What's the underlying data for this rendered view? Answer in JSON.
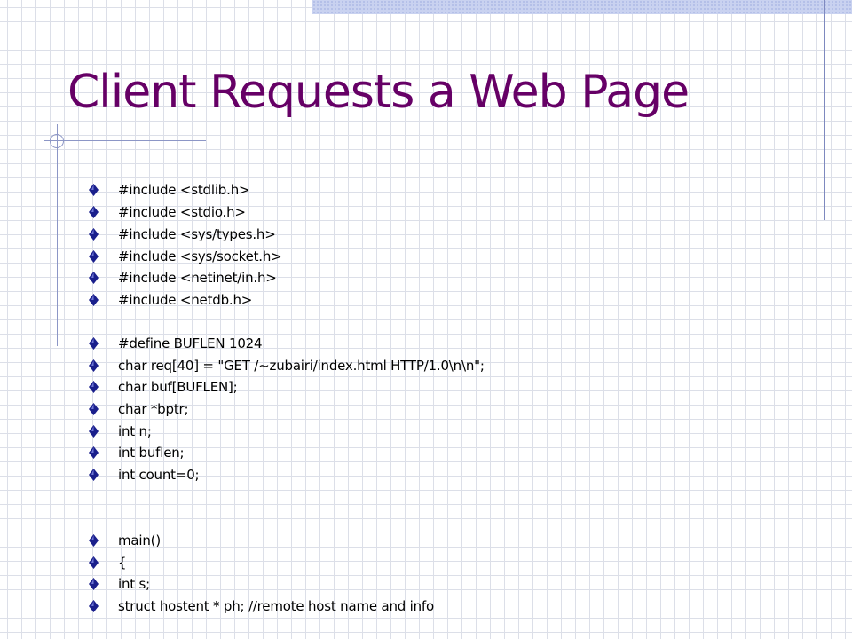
{
  "slide": {
    "title": "Client Requests a Web Page",
    "lines": [
      {
        "text": "#include <stdlib.h>"
      },
      {
        "text": "#include <stdio.h>"
      },
      {
        "text": "#include <sys/types.h>"
      },
      {
        "text": "#include <sys/socket.h>"
      },
      {
        "text": "#include <netinet/in.h>"
      },
      {
        "text": "#include <netdb.h>"
      },
      {
        "text": "#define BUFLEN 1024"
      },
      {
        "text": "char req[40] = \"GET /~zubairi/index.html HTTP/1.0\\n\\n\";"
      },
      {
        "text": "char buf[BUFLEN];"
      },
      {
        "text": "char *bptr;"
      },
      {
        "text": "int n;"
      },
      {
        "text": "int buflen;"
      },
      {
        "text": "int count=0;"
      },
      {
        "text": "main()"
      },
      {
        "text": "{"
      },
      {
        "text": "int s;"
      },
      {
        "text": "struct hostent * ph; //remote host name and info"
      }
    ]
  },
  "colors": {
    "title": "#660066",
    "text": "#000000",
    "bullet": "#1a1f8c",
    "grid": "#dcdfe8",
    "accent_line": "#8c96c6"
  }
}
